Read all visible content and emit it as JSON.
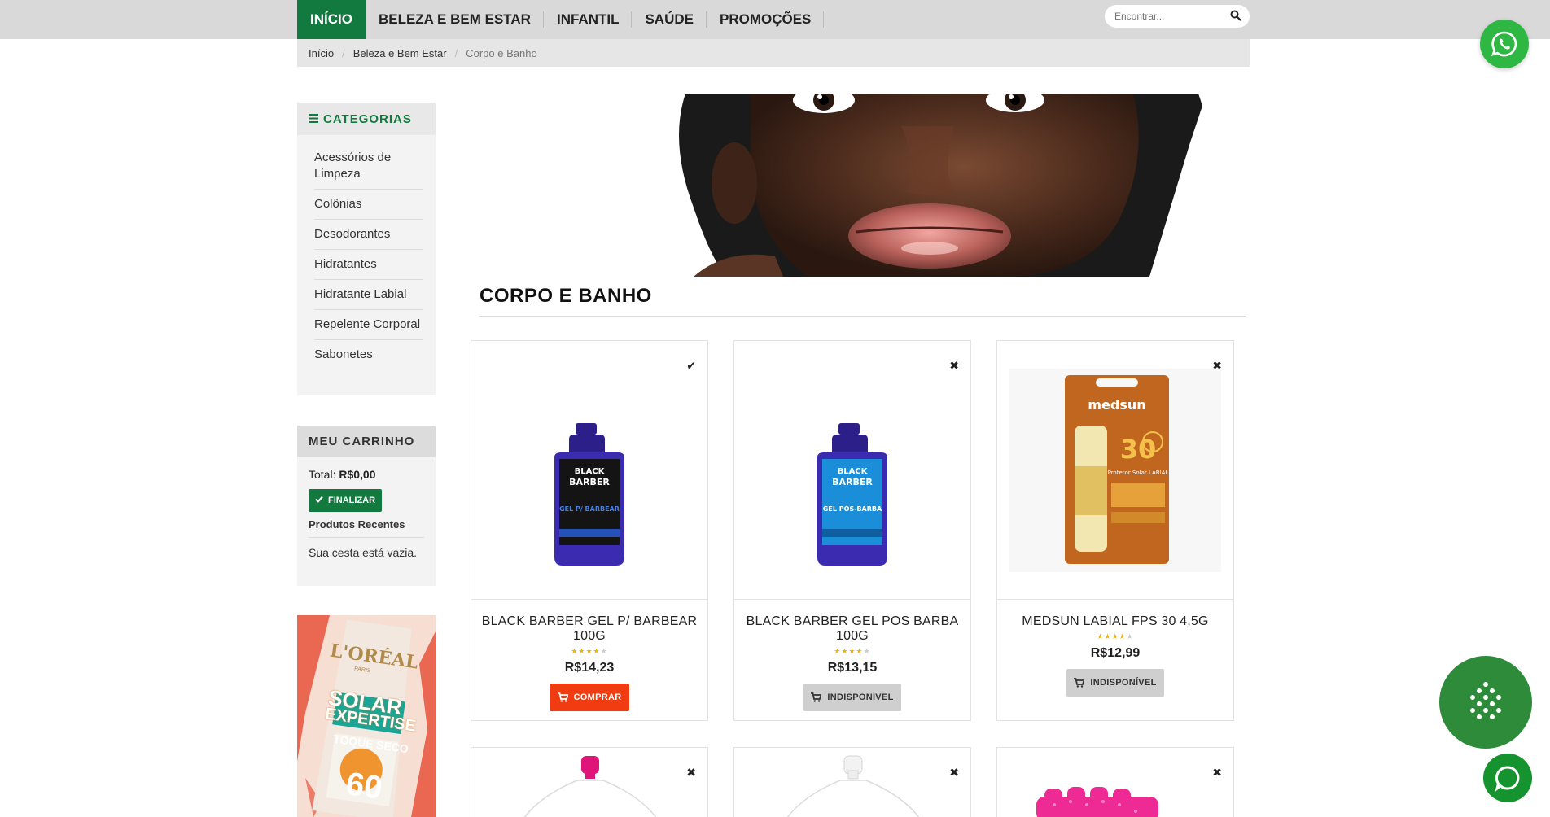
{
  "nav": {
    "items": [
      {
        "label": "INÍCIO"
      },
      {
        "label": "BELEZA E BEM ESTAR"
      },
      {
        "label": "INFANTIL"
      },
      {
        "label": "SAÚDE"
      },
      {
        "label": "PROMOÇÕES"
      }
    ],
    "search_placeholder": "Encontrar..."
  },
  "breadcrumb": {
    "items": [
      "Início",
      "Beleza e Bem Estar",
      "Corpo e Banho"
    ],
    "separator": "/"
  },
  "sidebar": {
    "categories_title": "CATEGORIAS",
    "categories": [
      "Acessórios de Limpeza",
      "Colônias",
      "Desodorantes",
      "Hidratantes",
      "Hidratante Labial",
      "Repelente Corporal",
      "Sabonetes"
    ],
    "cart": {
      "title": "MEU CARRINHO",
      "total_label": "Total:",
      "total_value": "R$0,00",
      "checkout_label": "FINALIZAR",
      "recent_title": "Produtos Recentes",
      "empty_text": "Sua cesta está vazia."
    },
    "ad": {
      "brand": "L'ORÉAL",
      "sub": "PARIS",
      "line1": "SOLAR",
      "line2": "EXPERTISE",
      "line3": "TOQUE SECO",
      "spf": "60"
    }
  },
  "main": {
    "title": "CORPO E BANHO",
    "products": [
      {
        "name": "BLACK BARBER GEL P/ BARBEAR 100G",
        "price": "R$14,23",
        "rating": 4,
        "button": "COMPRAR",
        "available": true,
        "mark": "✔",
        "label_top": "BLACK",
        "label_mid": "BARBER",
        "label_sub": "GEL P/ BARBEAR",
        "color": "#3b2bb0"
      },
      {
        "name": "BLACK BARBER GEL POS BARBA 100G",
        "price": "R$13,15",
        "rating": 4,
        "button": "INDISPONÍVEL",
        "available": false,
        "mark": "✖",
        "label_top": "BLACK",
        "label_mid": "BARBER",
        "label_sub": "GEL PÓS-BARBA",
        "color": "#3b2bb0"
      },
      {
        "name": "MEDSUN LABIAL FPS 30 4,5G",
        "price": "R$12,99",
        "rating": 4,
        "button": "INDISPONÍVEL",
        "available": false,
        "mark": "✖",
        "label_top": "medsun",
        "label_mid": "30",
        "label_sub": "Protetor Solar LABIAL",
        "color": "#c0661f"
      }
    ],
    "second_row_marks": [
      "✖",
      "✖",
      "✖"
    ]
  },
  "colors": {
    "brand_green": "#127a3e",
    "buy_red": "#f03c10",
    "whatsapp": "#2fb743"
  }
}
